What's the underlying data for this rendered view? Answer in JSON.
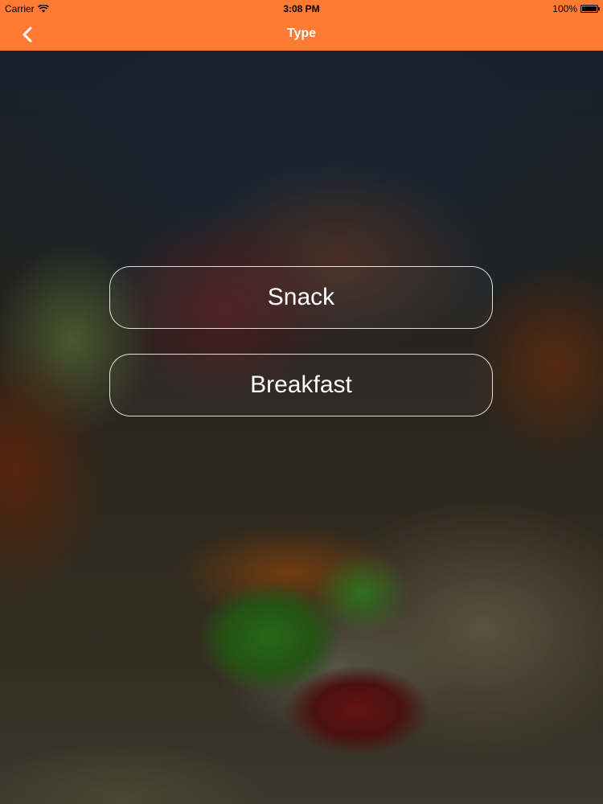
{
  "status_bar": {
    "carrier": "Carrier",
    "time": "3:08 PM",
    "battery": "100%",
    "battery_level": 1.0
  },
  "nav_bar": {
    "title": "Type",
    "back_icon": "chevron-left-icon",
    "color": "#fe7b34"
  },
  "options": [
    {
      "label": "Snack"
    },
    {
      "label": "Breakfast"
    }
  ]
}
